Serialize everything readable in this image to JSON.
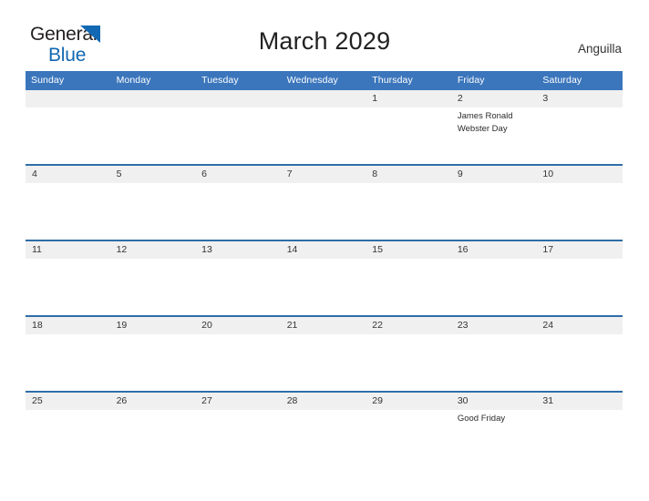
{
  "brand": {
    "line1": "General",
    "line2": "Blue",
    "triangle_color": "#1268b3",
    "text_color": "#231f20"
  },
  "header": {
    "title": "March 2029",
    "region": "Anguilla"
  },
  "theme": {
    "header_blue": "#3b76bc",
    "row_divider_blue": "#2e6da9",
    "date_band_gray": "#f0f0f0",
    "page_background": "#ffffff",
    "text_color": "#333333"
  },
  "calendar": {
    "weekdays": [
      "Sunday",
      "Monday",
      "Tuesday",
      "Wednesday",
      "Thursday",
      "Friday",
      "Saturday"
    ],
    "weeks": [
      {
        "days": [
          {
            "number": "",
            "events": []
          },
          {
            "number": "",
            "events": []
          },
          {
            "number": "",
            "events": []
          },
          {
            "number": "",
            "events": []
          },
          {
            "number": "1",
            "events": []
          },
          {
            "number": "2",
            "events": [
              "James Ronald",
              "Webster Day"
            ]
          },
          {
            "number": "3",
            "events": []
          }
        ]
      },
      {
        "days": [
          {
            "number": "4",
            "events": []
          },
          {
            "number": "5",
            "events": []
          },
          {
            "number": "6",
            "events": []
          },
          {
            "number": "7",
            "events": []
          },
          {
            "number": "8",
            "events": []
          },
          {
            "number": "9",
            "events": []
          },
          {
            "number": "10",
            "events": []
          }
        ]
      },
      {
        "days": [
          {
            "number": "11",
            "events": []
          },
          {
            "number": "12",
            "events": []
          },
          {
            "number": "13",
            "events": []
          },
          {
            "number": "14",
            "events": []
          },
          {
            "number": "15",
            "events": []
          },
          {
            "number": "16",
            "events": []
          },
          {
            "number": "17",
            "events": []
          }
        ]
      },
      {
        "days": [
          {
            "number": "18",
            "events": []
          },
          {
            "number": "19",
            "events": []
          },
          {
            "number": "20",
            "events": []
          },
          {
            "number": "21",
            "events": []
          },
          {
            "number": "22",
            "events": []
          },
          {
            "number": "23",
            "events": []
          },
          {
            "number": "24",
            "events": []
          }
        ]
      },
      {
        "days": [
          {
            "number": "25",
            "events": []
          },
          {
            "number": "26",
            "events": []
          },
          {
            "number": "27",
            "events": []
          },
          {
            "number": "28",
            "events": []
          },
          {
            "number": "29",
            "events": []
          },
          {
            "number": "30",
            "events": [
              "Good Friday"
            ]
          },
          {
            "number": "31",
            "events": []
          }
        ]
      }
    ]
  }
}
